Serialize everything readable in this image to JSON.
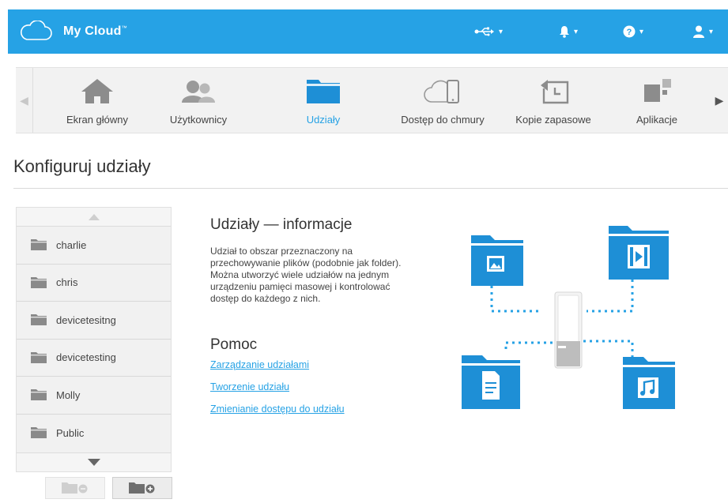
{
  "app": {
    "title": "My Cloud",
    "trademark": "™"
  },
  "topbar": {
    "icons": [
      "usb-icon",
      "bell-icon",
      "help-icon",
      "user-icon"
    ]
  },
  "nav": {
    "items": [
      {
        "label": "Ekran główny",
        "icon": "home-icon",
        "active": false
      },
      {
        "label": "Użytkownicy",
        "icon": "users-icon",
        "active": false
      },
      {
        "label": "Udziały",
        "icon": "shares-icon",
        "active": true
      },
      {
        "label": "Dostęp do chmury",
        "icon": "cloud-access-icon",
        "active": false
      },
      {
        "label": "Kopie zapasowe",
        "icon": "backup-icon",
        "active": false
      },
      {
        "label": "Aplikacje",
        "icon": "apps-icon",
        "active": false
      }
    ]
  },
  "page": {
    "title": "Konfiguruj udziały"
  },
  "shares": {
    "items": [
      "charlie",
      "chris",
      "devicetesitng",
      "devicetesting",
      "Molly",
      "Public"
    ]
  },
  "info": {
    "title": "Udziały — informacje",
    "text": "Udział to obszar przeznaczony na przechowywanie plików (podobnie jak folder). Można utworzyć wiele udziałów na jednym urządzeniu pamięci masowej i kontrolować dostęp do każdego z nich."
  },
  "help": {
    "title": "Pomoc",
    "links": [
      "Zarządzanie udziałami",
      "Tworzenie udziału",
      "Zmienianie dostępu do udziału"
    ]
  },
  "colors": {
    "accent": "#26a2e5",
    "folder": "#1e8fd6"
  }
}
